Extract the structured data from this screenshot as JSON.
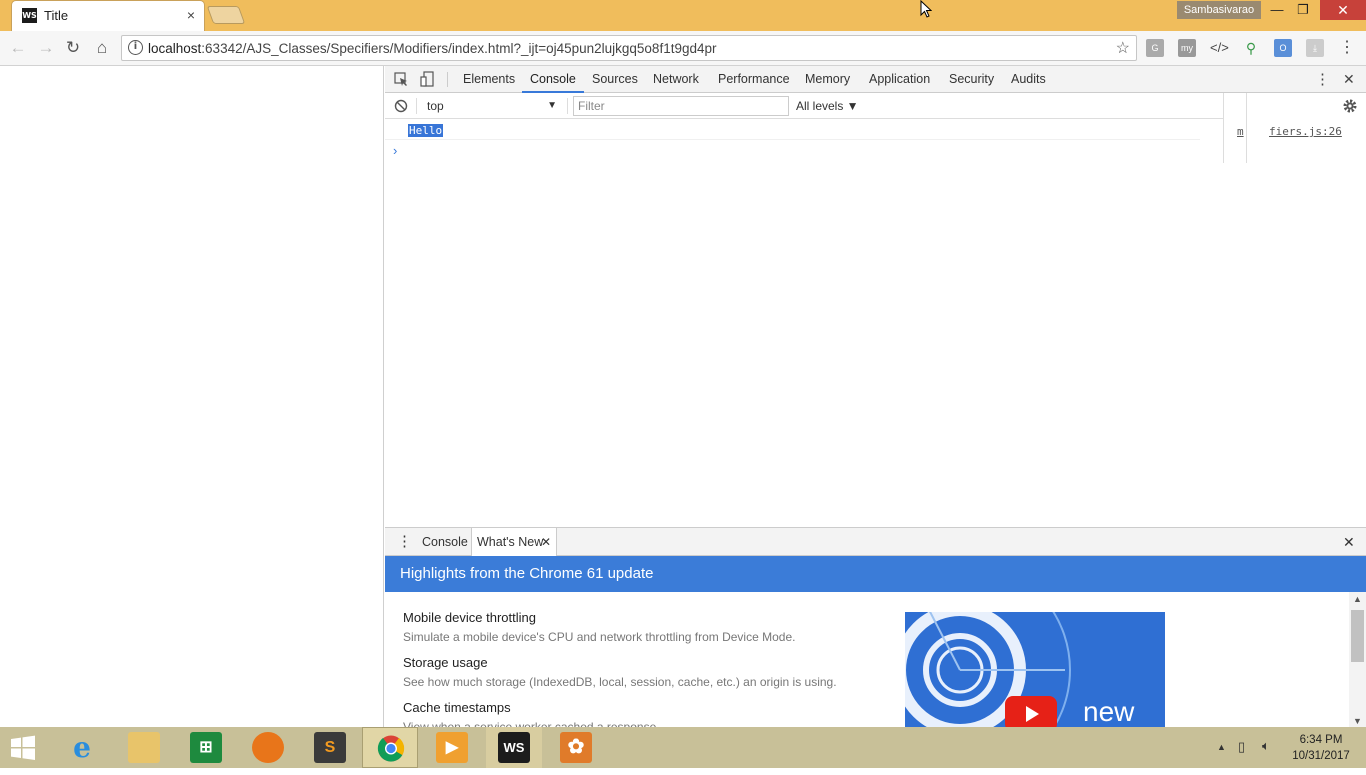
{
  "browser": {
    "tab_title": "Title",
    "tab_close": "×",
    "user_name": "Sambasivarao",
    "minimize": "—",
    "restore": "❐",
    "close": "✕",
    "url_host": "localhost",
    "url_rest": ":63342/AJS_Classes/Specifiers/Modifiers/index.html?_ijt=oj45pun2lujkgq5o8f1t9gd4pr",
    "favicon_text": "WS",
    "star": "☆"
  },
  "devtools": {
    "tabs": [
      "Elements",
      "Console",
      "Sources",
      "Network",
      "Performance",
      "Memory",
      "Application",
      "Security",
      "Audits"
    ],
    "active_tab": "Console",
    "context": "top",
    "filter_placeholder": "Filter",
    "levels": "All levels ▼",
    "log_message": "Hello",
    "source_link_a": "m",
    "source_link": "fiers.js:26",
    "prompt": "›",
    "close": "✕",
    "menu": "⋮"
  },
  "drawer": {
    "tabs": [
      "Console",
      "What's New"
    ],
    "active_tab": "What's New",
    "banner": "Highlights from the Chrome 61 update",
    "items": [
      {
        "title": "Mobile device throttling",
        "desc": "Simulate a mobile device's CPU and network throttling from Device Mode."
      },
      {
        "title": "Storage usage",
        "desc": "See how much storage (IndexedDB, local, session, cache, etc.) an origin is using."
      },
      {
        "title": "Cache timestamps",
        "desc": "View when a service worker cached a response."
      }
    ],
    "video_label": "new"
  },
  "taskbar": {
    "time": "6:34 PM",
    "date": "10/31/2017"
  },
  "colors": {
    "chrome_titlebar": "#f0bd5c",
    "devtools_accent": "#3879d9",
    "banner": "#3b7cd8",
    "taskbar": "#c8c098"
  }
}
